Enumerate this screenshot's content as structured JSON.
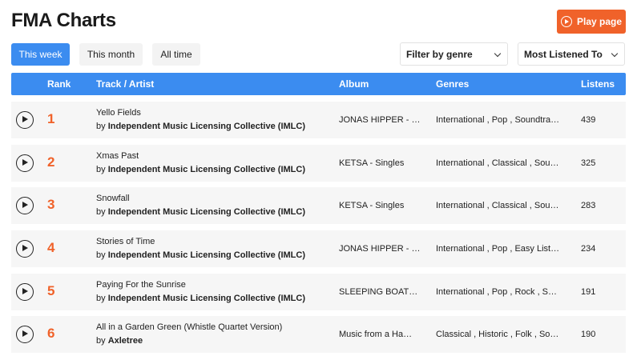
{
  "header": {
    "title": "FMA Charts",
    "play_page_label": "Play page"
  },
  "tabs": [
    {
      "label": "This week",
      "active": true
    },
    {
      "label": "This month",
      "active": false
    },
    {
      "label": "All time",
      "active": false
    }
  ],
  "filters": {
    "genre_label": "Filter by genre",
    "sort_label": "Most Listened To"
  },
  "table": {
    "columns": [
      "Rank",
      "Track / Artist",
      "Album",
      "Genres",
      "Listens"
    ],
    "by_prefix": "by",
    "rows": [
      {
        "rank": "1",
        "track": "Yello Fields",
        "artist": "Independent Music Licensing Collective (IMLC)",
        "album": "JONAS HIPPER - …",
        "genres": "International , Pop , Soundtra…",
        "listens": "439"
      },
      {
        "rank": "2",
        "track": "Xmas Past",
        "artist": "Independent Music Licensing Collective (IMLC)",
        "album": "KETSA - Singles",
        "genres": "International , Classical , Sou…",
        "listens": "325"
      },
      {
        "rank": "3",
        "track": "Snowfall",
        "artist": "Independent Music Licensing Collective (IMLC)",
        "album": "KETSA - Singles",
        "genres": "International , Classical , Sou…",
        "listens": "283"
      },
      {
        "rank": "4",
        "track": "Stories of Time",
        "artist": "Independent Music Licensing Collective (IMLC)",
        "album": "JONAS HIPPER - …",
        "genres": "International , Pop , Easy List…",
        "listens": "234"
      },
      {
        "rank": "5",
        "track": "Paying For the Sunrise",
        "artist": "Independent Music Licensing Collective (IMLC)",
        "album": "SLEEPING BOATS…",
        "genres": "International , Pop , Rock , S…",
        "listens": "191"
      },
      {
        "rank": "6",
        "track": "All in a Garden Green (Whistle Quartet Version)",
        "artist": "Axletree",
        "album": "Music from a Ha…",
        "genres": "Classical , Historic , Folk , So…",
        "listens": "190"
      }
    ]
  },
  "colors": {
    "accent_blue": "#3b8cf0",
    "accent_orange": "#f0622a"
  }
}
